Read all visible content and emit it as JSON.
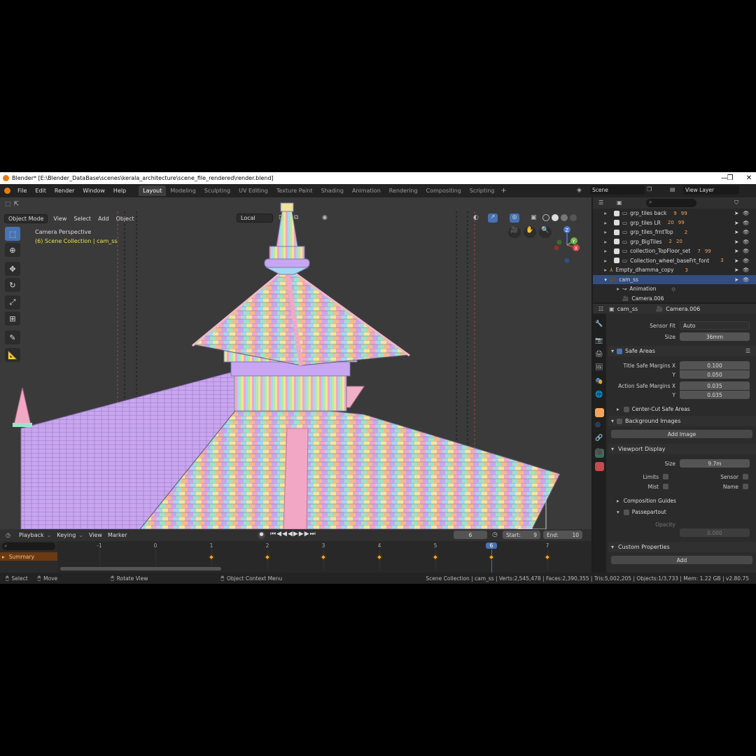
{
  "window": {
    "title": "Blender* [E:\\Blender_DataBase\\scenes\\kerala_architecture\\scene_file_rendered\\render.blend]",
    "controls": [
      "—",
      "❐",
      "✕"
    ]
  },
  "menu": [
    "File",
    "Edit",
    "Render",
    "Window",
    "Help"
  ],
  "workspaces": [
    {
      "label": "Layout",
      "active": true
    },
    {
      "label": "Modeling"
    },
    {
      "label": "Sculpting"
    },
    {
      "label": "UV Editing"
    },
    {
      "label": "Texture Paint"
    },
    {
      "label": "Shading"
    },
    {
      "label": "Animation"
    },
    {
      "label": "Rendering"
    },
    {
      "label": "Compositing"
    },
    {
      "label": "Scripting"
    }
  ],
  "scene": {
    "label": "Scene",
    "view_layer": "View Layer"
  },
  "viewport": {
    "mode": "Object Mode",
    "menus": [
      "View",
      "Select",
      "Add",
      "Object"
    ],
    "orientation": "Local",
    "overlay_title": "Camera Perspective",
    "overlay_subtitle": "(6) Scene Collection | cam_ss",
    "gizmo_axes": {
      "x": "X",
      "y": "Y",
      "z": "Z"
    }
  },
  "tools": [
    "select-box",
    "cursor",
    "move",
    "rotate",
    "scale",
    "transform",
    "annotate",
    "measure"
  ],
  "outliner": {
    "rows": [
      {
        "label": "grp_tiles back",
        "badge1": "9",
        "badge2": "99"
      },
      {
        "label": "grp_tiles LR",
        "badge1": "20",
        "badge2": "99"
      },
      {
        "label": "grp_tiles_frntTop",
        "badge1": "",
        "badge2": "2"
      },
      {
        "label": "grp_BigTiles",
        "badge1": "2",
        "badge2": "20"
      },
      {
        "label": "collection_TopFloor_set",
        "badge1": "7",
        "badge2": "99"
      },
      {
        "label": "Collection_wheel_baseFrt_font",
        "badge1": "",
        "badge2": "3"
      },
      {
        "label": "Empty_dhamma_copy",
        "badge1": "",
        "badge2": "3"
      },
      {
        "label": "cam_ss",
        "badge1": "",
        "badge2": "",
        "selected": true
      },
      {
        "label": "Animation",
        "badge1": "",
        "badge2": ""
      },
      {
        "label": "Camera.006",
        "badge1": "",
        "badge2": ""
      }
    ]
  },
  "properties": {
    "object": "cam_ss",
    "data": "Camera.006",
    "sensor_fit_label": "Sensor Fit",
    "sensor_fit": "Auto",
    "size_label": "Size",
    "sensor_size": "36mm",
    "safe_areas": "Safe Areas",
    "title_safe_x_label": "Title Safe Margins X",
    "title_safe_x": "0.100",
    "y_label": "Y",
    "title_safe_y": "0.050",
    "action_safe_x_label": "Action Safe Margins X",
    "action_safe_x": "0.035",
    "action_safe_y": "0.035",
    "center_cut": "Center-Cut Safe Areas",
    "background_images": "Background Images",
    "add_image": "Add Image",
    "viewport_display": "Viewport Display",
    "display_size": "9.7m",
    "limits": "Limits",
    "sensor": "Sensor",
    "mist": "Mist",
    "name": "Name",
    "composition_guides": "Composition Guides",
    "passepartout": "Passepartout",
    "opacity_label": "Opacity",
    "opacity": "0.000",
    "custom_properties": "Custom Properties",
    "add": "Add"
  },
  "timeline": {
    "menus": [
      "Playback",
      "Keying",
      "View",
      "Marker"
    ],
    "current_frame": "6",
    "start_label": "Start:",
    "start": "9",
    "end_label": "End:",
    "end": "10",
    "ticks": [
      "-1",
      "0",
      "1",
      "2",
      "3",
      "4",
      "5",
      "6",
      "7"
    ],
    "summary": "Summary",
    "keyframes": [
      1,
      2,
      3,
      4,
      5,
      6,
      7
    ]
  },
  "status": {
    "select": "Select",
    "move": "Move",
    "rotate": "Rotate View",
    "context": "Object Context Menu",
    "stats": "Scene Collection | cam_ss | Verts:2,545,478 | Faces:2,390,355 | Tris:5,002,205 | Objects:1/3,733 | Mem: 1.22 GB | v2.80.75"
  },
  "colors": {
    "accent": "#4772b3",
    "selected_row": "#334d80",
    "keyframe": "#f5a623",
    "frame_indicator": "#4772b3",
    "camera_text": "#e6e34b"
  }
}
